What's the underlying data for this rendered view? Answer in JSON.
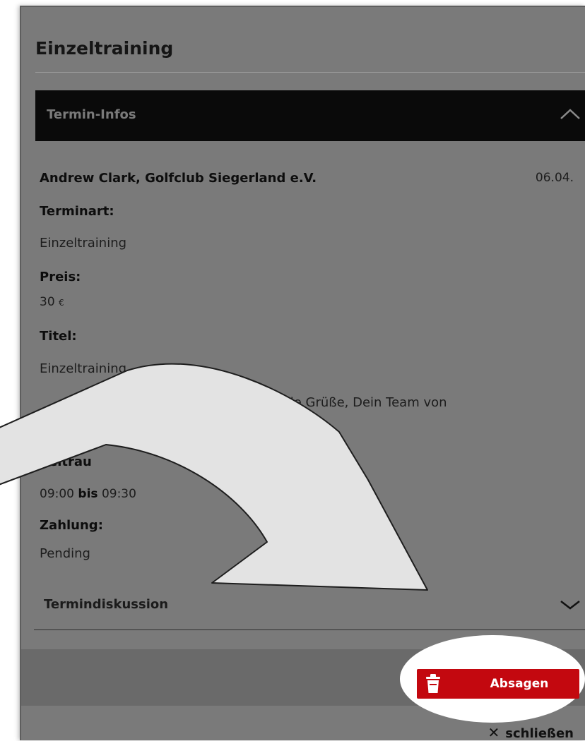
{
  "dialog": {
    "title": "Einzeltraining",
    "info_header": "Termin-Infos",
    "trainer": "Andrew Clark, Golfclub Siegerland e.V.",
    "date": "06.04.",
    "fields": {
      "type_label": "Terminart:",
      "type_value": "Einzeltraining",
      "price_label": "Preis:",
      "price_value": "30",
      "price_currency": "€",
      "title_label": "Titel:",
      "title_value": "Einzeltraining",
      "note_visible": "ist eine Testbuchung. Viele Grüße, Dein Team von",
      "period_label_visible": "Zeitrau",
      "time_start": "09:00",
      "time_to": "bis",
      "time_end": "09:30",
      "payment_label": "Zahlung:",
      "payment_value": "Pending"
    },
    "discussion_header": "Termindiskussion"
  },
  "actions": {
    "cancel_label": "Absagen",
    "close_label": "schließen"
  },
  "icons": {
    "collapse": "chevron-up-icon",
    "expand": "chevron-down-icon",
    "trash": "trash-icon",
    "close": "close-icon"
  },
  "colors": {
    "overlay_panel": "#7a7a7a",
    "header_bar": "#0a0a0a",
    "cancel_button": "#c3080f",
    "annotation_arrow": "#e3e3e3"
  }
}
